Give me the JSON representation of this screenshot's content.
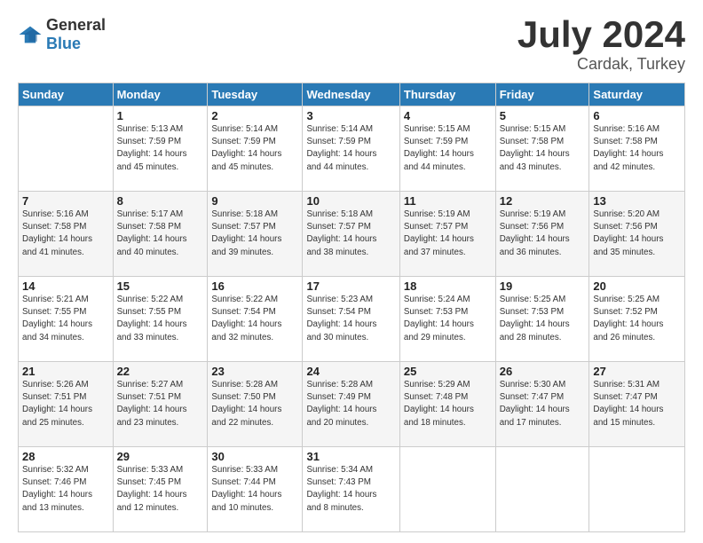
{
  "header": {
    "logo_general": "General",
    "logo_blue": "Blue",
    "month": "July 2024",
    "location": "Cardak, Turkey"
  },
  "weekdays": [
    "Sunday",
    "Monday",
    "Tuesday",
    "Wednesday",
    "Thursday",
    "Friday",
    "Saturday"
  ],
  "weeks": [
    [
      {
        "day": "",
        "info": ""
      },
      {
        "day": "1",
        "info": "Sunrise: 5:13 AM\nSunset: 7:59 PM\nDaylight: 14 hours\nand 45 minutes."
      },
      {
        "day": "2",
        "info": "Sunrise: 5:14 AM\nSunset: 7:59 PM\nDaylight: 14 hours\nand 45 minutes."
      },
      {
        "day": "3",
        "info": "Sunrise: 5:14 AM\nSunset: 7:59 PM\nDaylight: 14 hours\nand 44 minutes."
      },
      {
        "day": "4",
        "info": "Sunrise: 5:15 AM\nSunset: 7:59 PM\nDaylight: 14 hours\nand 44 minutes."
      },
      {
        "day": "5",
        "info": "Sunrise: 5:15 AM\nSunset: 7:58 PM\nDaylight: 14 hours\nand 43 minutes."
      },
      {
        "day": "6",
        "info": "Sunrise: 5:16 AM\nSunset: 7:58 PM\nDaylight: 14 hours\nand 42 minutes."
      }
    ],
    [
      {
        "day": "7",
        "info": "Sunrise: 5:16 AM\nSunset: 7:58 PM\nDaylight: 14 hours\nand 41 minutes."
      },
      {
        "day": "8",
        "info": "Sunrise: 5:17 AM\nSunset: 7:58 PM\nDaylight: 14 hours\nand 40 minutes."
      },
      {
        "day": "9",
        "info": "Sunrise: 5:18 AM\nSunset: 7:57 PM\nDaylight: 14 hours\nand 39 minutes."
      },
      {
        "day": "10",
        "info": "Sunrise: 5:18 AM\nSunset: 7:57 PM\nDaylight: 14 hours\nand 38 minutes."
      },
      {
        "day": "11",
        "info": "Sunrise: 5:19 AM\nSunset: 7:57 PM\nDaylight: 14 hours\nand 37 minutes."
      },
      {
        "day": "12",
        "info": "Sunrise: 5:19 AM\nSunset: 7:56 PM\nDaylight: 14 hours\nand 36 minutes."
      },
      {
        "day": "13",
        "info": "Sunrise: 5:20 AM\nSunset: 7:56 PM\nDaylight: 14 hours\nand 35 minutes."
      }
    ],
    [
      {
        "day": "14",
        "info": "Sunrise: 5:21 AM\nSunset: 7:55 PM\nDaylight: 14 hours\nand 34 minutes."
      },
      {
        "day": "15",
        "info": "Sunrise: 5:22 AM\nSunset: 7:55 PM\nDaylight: 14 hours\nand 33 minutes."
      },
      {
        "day": "16",
        "info": "Sunrise: 5:22 AM\nSunset: 7:54 PM\nDaylight: 14 hours\nand 32 minutes."
      },
      {
        "day": "17",
        "info": "Sunrise: 5:23 AM\nSunset: 7:54 PM\nDaylight: 14 hours\nand 30 minutes."
      },
      {
        "day": "18",
        "info": "Sunrise: 5:24 AM\nSunset: 7:53 PM\nDaylight: 14 hours\nand 29 minutes."
      },
      {
        "day": "19",
        "info": "Sunrise: 5:25 AM\nSunset: 7:53 PM\nDaylight: 14 hours\nand 28 minutes."
      },
      {
        "day": "20",
        "info": "Sunrise: 5:25 AM\nSunset: 7:52 PM\nDaylight: 14 hours\nand 26 minutes."
      }
    ],
    [
      {
        "day": "21",
        "info": "Sunrise: 5:26 AM\nSunset: 7:51 PM\nDaylight: 14 hours\nand 25 minutes."
      },
      {
        "day": "22",
        "info": "Sunrise: 5:27 AM\nSunset: 7:51 PM\nDaylight: 14 hours\nand 23 minutes."
      },
      {
        "day": "23",
        "info": "Sunrise: 5:28 AM\nSunset: 7:50 PM\nDaylight: 14 hours\nand 22 minutes."
      },
      {
        "day": "24",
        "info": "Sunrise: 5:28 AM\nSunset: 7:49 PM\nDaylight: 14 hours\nand 20 minutes."
      },
      {
        "day": "25",
        "info": "Sunrise: 5:29 AM\nSunset: 7:48 PM\nDaylight: 14 hours\nand 18 minutes."
      },
      {
        "day": "26",
        "info": "Sunrise: 5:30 AM\nSunset: 7:47 PM\nDaylight: 14 hours\nand 17 minutes."
      },
      {
        "day": "27",
        "info": "Sunrise: 5:31 AM\nSunset: 7:47 PM\nDaylight: 14 hours\nand 15 minutes."
      }
    ],
    [
      {
        "day": "28",
        "info": "Sunrise: 5:32 AM\nSunset: 7:46 PM\nDaylight: 14 hours\nand 13 minutes."
      },
      {
        "day": "29",
        "info": "Sunrise: 5:33 AM\nSunset: 7:45 PM\nDaylight: 14 hours\nand 12 minutes."
      },
      {
        "day": "30",
        "info": "Sunrise: 5:33 AM\nSunset: 7:44 PM\nDaylight: 14 hours\nand 10 minutes."
      },
      {
        "day": "31",
        "info": "Sunrise: 5:34 AM\nSunset: 7:43 PM\nDaylight: 14 hours\nand 8 minutes."
      },
      {
        "day": "",
        "info": ""
      },
      {
        "day": "",
        "info": ""
      },
      {
        "day": "",
        "info": ""
      }
    ]
  ]
}
